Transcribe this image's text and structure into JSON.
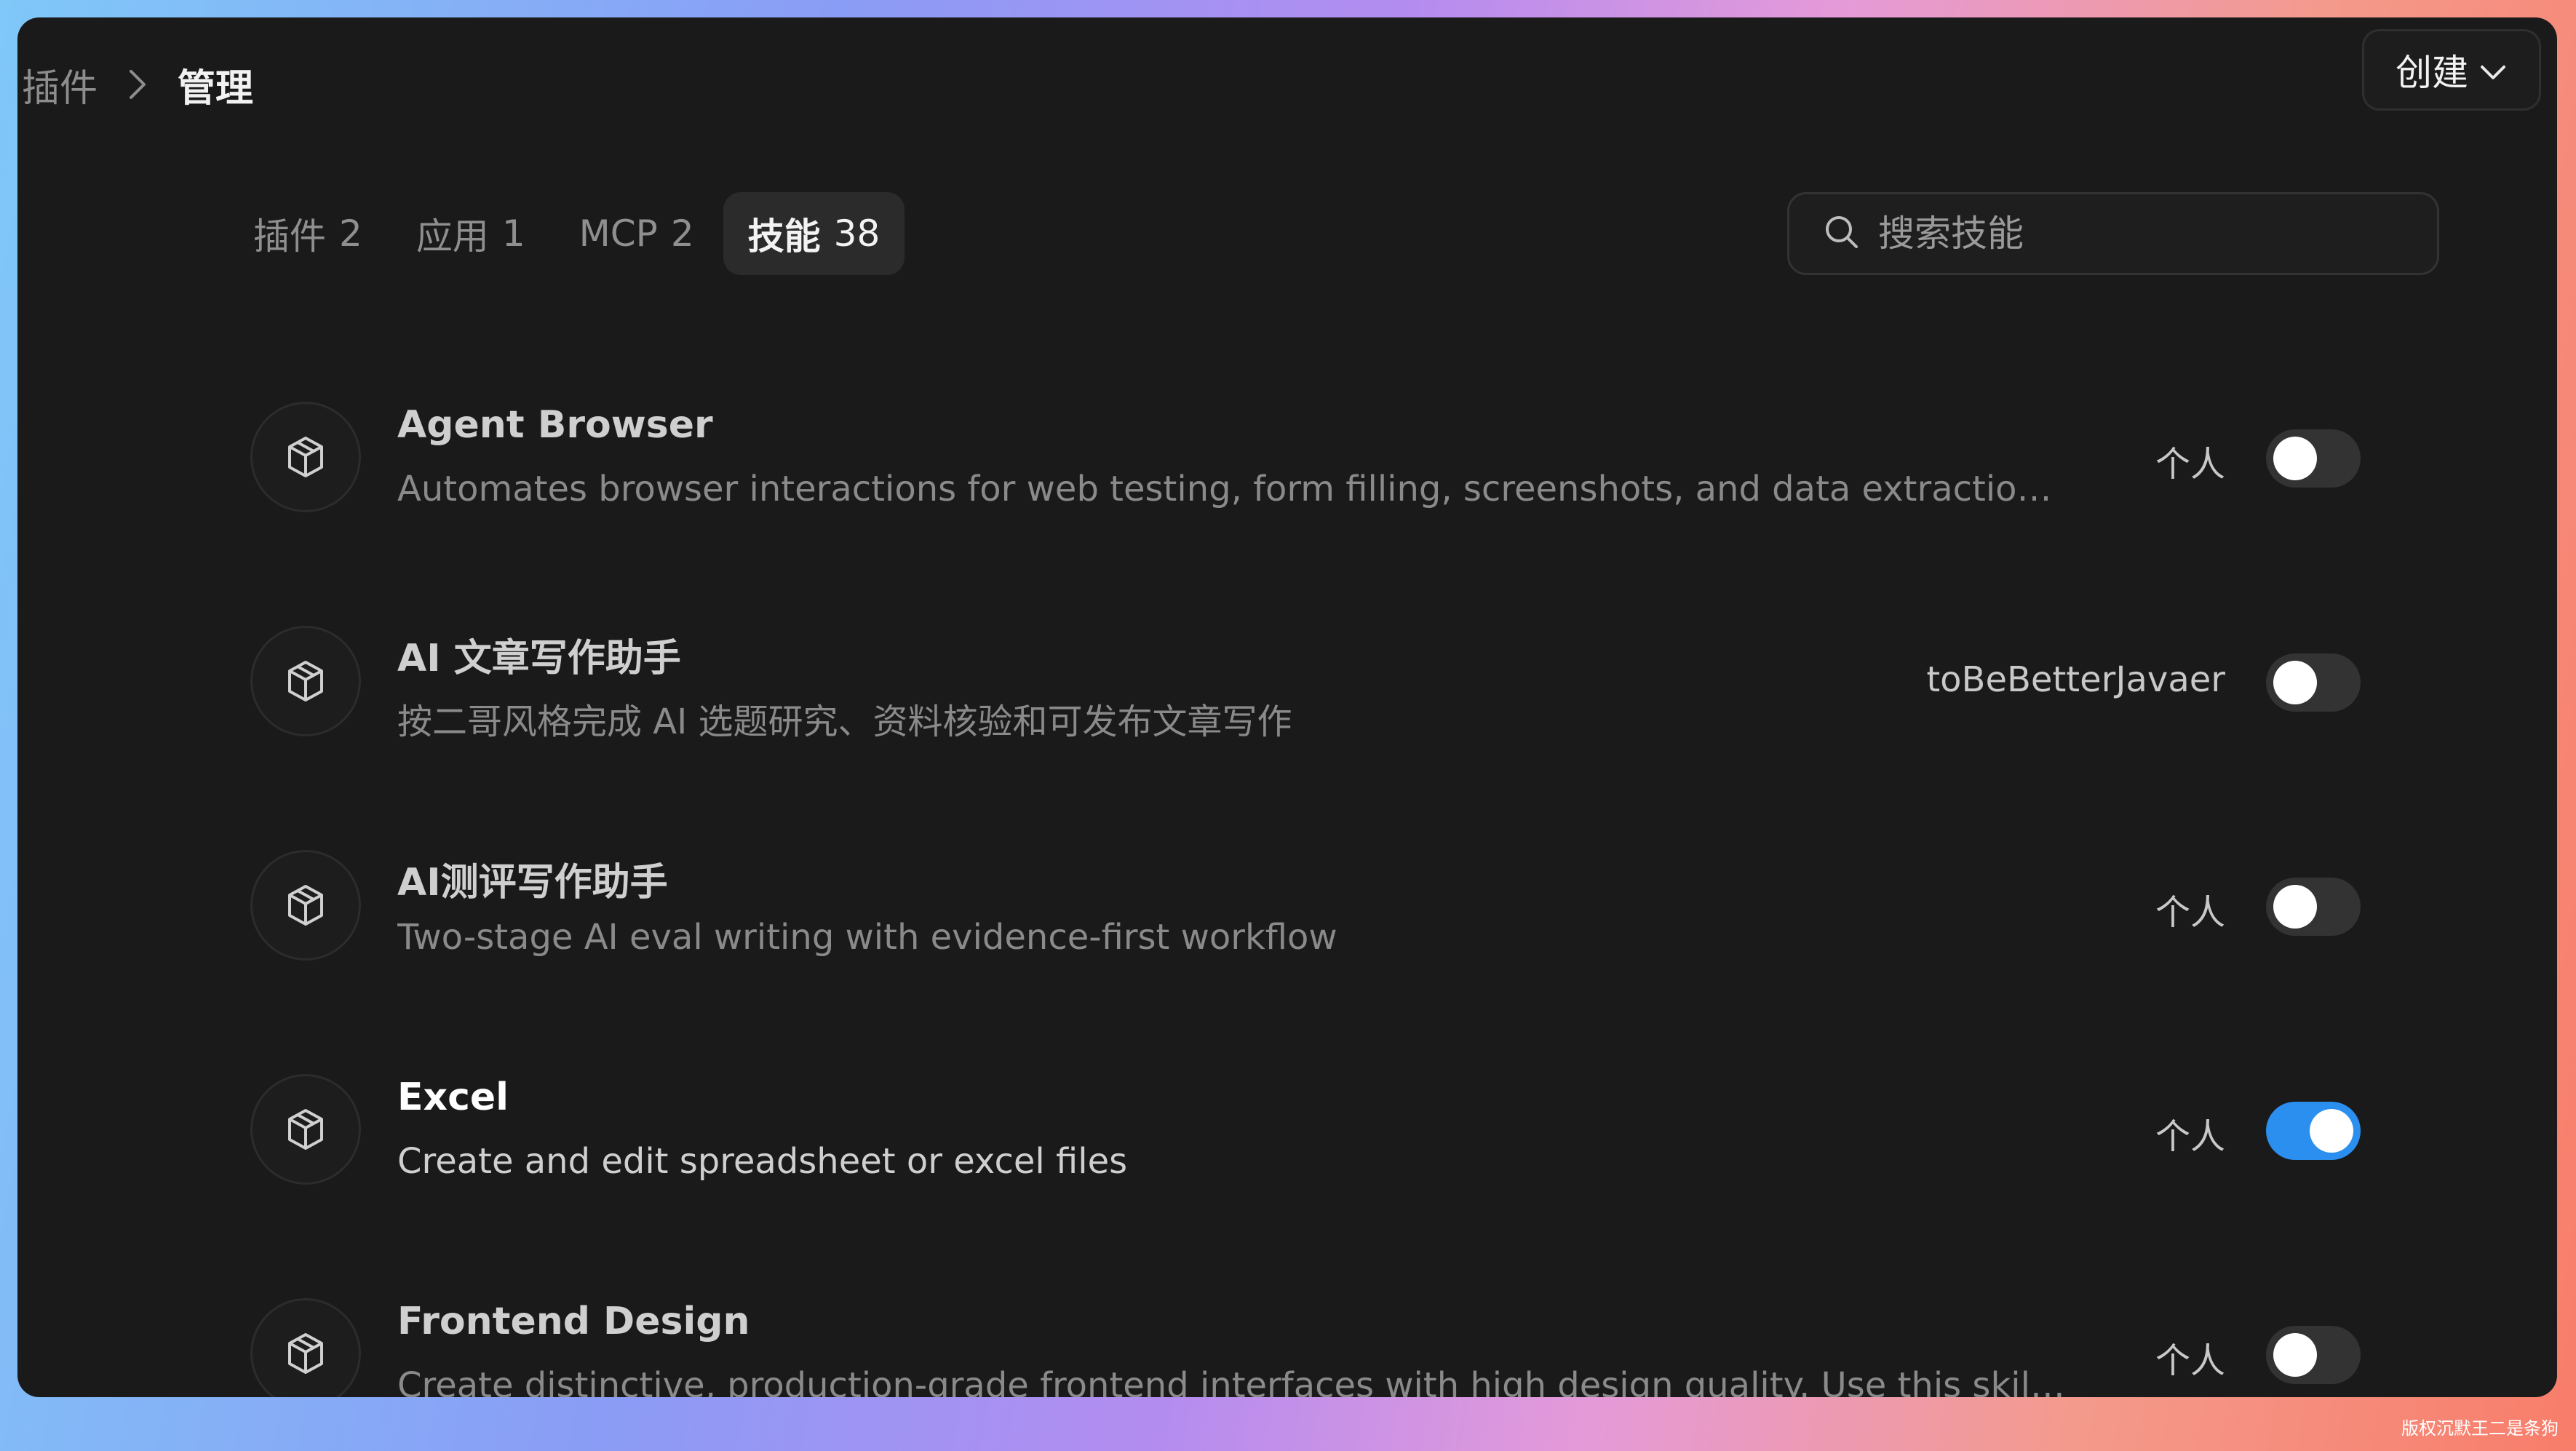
{
  "breadcrumb": {
    "parent": "插件",
    "current": "管理"
  },
  "header": {
    "create_label": "创建"
  },
  "tabs": [
    {
      "label": "插件",
      "count": "2",
      "active": false
    },
    {
      "label": "应用",
      "count": "1",
      "active": false
    },
    {
      "label": "MCP",
      "count": "2",
      "active": false
    },
    {
      "label": "技能",
      "count": "38",
      "active": true
    }
  ],
  "search": {
    "placeholder": "搜索技能",
    "value": ""
  },
  "skills": [
    {
      "name": "Agent Browser",
      "description": "Automates browser interactions for web testing, form filling, screenshots, and data extraction. Use when the user needs to navigate websites, interact with web pages",
      "scope": "个人",
      "enabled": false
    },
    {
      "name": "AI 文章写作助手",
      "description": "按二哥风格完成 AI 选题研究、资料核验和可发布文章写作",
      "scope": "toBeBetterJavaer",
      "enabled": false
    },
    {
      "name": "AI测评写作助手",
      "description": "Two-stage AI eval writing with evidence-first workflow",
      "scope": "个人",
      "enabled": false
    },
    {
      "name": "Excel",
      "description": "Create and edit spreadsheet or excel files",
      "scope": "个人",
      "enabled": true
    },
    {
      "name": "Frontend Design",
      "description": "Create distinctive, production-grade frontend interfaces with high design quality. Use this skill when the user asks to build web components, pages, or applications",
      "scope": "个人",
      "enabled": false
    }
  ],
  "watermark": "版权沉默王二是条狗",
  "colors": {
    "accent": "#2b8fef",
    "background": "#1a1a1a",
    "toggle_off": "#333333"
  }
}
